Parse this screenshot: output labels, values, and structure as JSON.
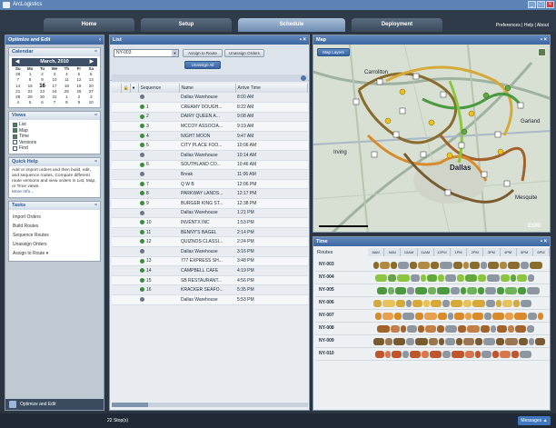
{
  "app": {
    "title": "ArcLogistics"
  },
  "tabs": [
    "Home",
    "Setup",
    "Schedule",
    "Deployment"
  ],
  "toplinks": "Preferences | Help | About",
  "left": {
    "header": "Optimize and Edit",
    "calendar": {
      "title": "Calendar",
      "month": "March, 2010",
      "days": [
        "Su",
        "Mo",
        "Tu",
        "We",
        "Th",
        "Fr",
        "Sa"
      ],
      "weeks": [
        [
          "28",
          "1",
          "2",
          "3",
          "4",
          "5",
          "6"
        ],
        [
          "7",
          "8",
          "9",
          "10",
          "11",
          "12",
          "13"
        ],
        [
          "14",
          "15",
          "16",
          "17",
          "18",
          "19",
          "20"
        ],
        [
          "21",
          "22",
          "23",
          "24",
          "25",
          "26",
          "27"
        ],
        [
          "28",
          "29",
          "30",
          "31",
          "1",
          "2",
          "3"
        ],
        [
          "4",
          "5",
          "6",
          "7",
          "8",
          "9",
          "10"
        ]
      ]
    },
    "views": {
      "title": "Views",
      "items": [
        "List",
        "Map",
        "Time",
        "Versions",
        "Find"
      ]
    },
    "quickhelp": {
      "title": "Quick Help",
      "text": "Add or import orders and then build, edit, and sequence routes. Compare different route versions and view orders in List, Map, or Time views.",
      "more": "More Info..."
    },
    "tasks": {
      "title": "Tasks",
      "items": [
        "Import Orders",
        "Build Routes",
        "Sequence Routes",
        "Unassign Orders",
        "Assign to Route"
      ]
    },
    "footer": "Optimize and Edit"
  },
  "list": {
    "title": "List",
    "combo": "NY-003",
    "buttons": {
      "assign": "Assign to Route",
      "unassign": "Unassign Orders",
      "unassign_all": "Unassign All"
    },
    "columns": [
      "Sequence",
      "Name",
      "Arrive Time"
    ],
    "rows": [
      {
        "seq": "",
        "name": "Dallas Warehouse",
        "time": "8:00 AM"
      },
      {
        "seq": "1",
        "name": "CREAMY DOUGH...",
        "time": "8:22 AM"
      },
      {
        "seq": "2",
        "name": "DAIRY QUEEN A...",
        "time": "9:08 AM"
      },
      {
        "seq": "3",
        "name": "MCCOY ASSOCIA...",
        "time": "9:19 AM"
      },
      {
        "seq": "4",
        "name": "NIGHT MOON",
        "time": "9:47 AM"
      },
      {
        "seq": "5",
        "name": "CITY PLACE FOO...",
        "time": "10:06 AM"
      },
      {
        "seq": "",
        "name": "Dallas Warehouse",
        "time": "10:14 AM"
      },
      {
        "seq": "6",
        "name": "SOUTHLAND CO...",
        "time": "10:46 AM"
      },
      {
        "seq": "",
        "name": "Break",
        "time": "11:06 AM"
      },
      {
        "seq": "7",
        "name": "Q W B",
        "time": "12:06 PM"
      },
      {
        "seq": "8",
        "name": "PARKWAY LANDS...",
        "time": "12:17 PM"
      },
      {
        "seq": "9",
        "name": "BURGER KING ST...",
        "time": "12:38 PM"
      },
      {
        "seq": "",
        "name": "Dallas Warehouse",
        "time": "1:21 PM"
      },
      {
        "seq": "10",
        "name": "INVENTX INC",
        "time": "1:53 PM"
      },
      {
        "seq": "11",
        "name": "BENNY'S BAGEL",
        "time": "2:14 PM"
      },
      {
        "seq": "12",
        "name": "QUIZNOS CLASSI...",
        "time": "2:24 PM"
      },
      {
        "seq": "",
        "name": "Dallas Warehouse",
        "time": "3:16 PM"
      },
      {
        "seq": "13",
        "name": "777 EXPRESS SH...",
        "time": "3:48 PM"
      },
      {
        "seq": "14",
        "name": "CAMPBELL CAFE",
        "time": "4:19 PM"
      },
      {
        "seq": "15",
        "name": "SB RESTAURANT...",
        "time": "4:56 PM"
      },
      {
        "seq": "16",
        "name": "KRACKER SEAFO...",
        "time": "5:35 PM"
      },
      {
        "seq": "",
        "name": "Dallas Warehouse",
        "time": "5:53 PM"
      }
    ]
  },
  "map": {
    "title": "Map",
    "layers_button": "Map Layers",
    "labels": [
      "Carrollton",
      "Irving",
      "Dallas",
      "Garland",
      "Mesquite"
    ],
    "esri": "ESRI"
  },
  "time": {
    "title": "Time",
    "routes_label": "Routes",
    "hours": [
      "8AM",
      "9AM",
      "10AM",
      "11AM",
      "12PM",
      "1PM",
      "2PM",
      "3PM",
      "4PM",
      "5PM",
      "6PM"
    ],
    "routes": [
      "NY-003",
      "NY-004",
      "NY-005",
      "NY-006",
      "NY-007",
      "NY-008",
      "NY-009",
      "NY-010"
    ]
  },
  "status": {
    "stops": "22 Stop(s)",
    "messages": "Messages"
  }
}
